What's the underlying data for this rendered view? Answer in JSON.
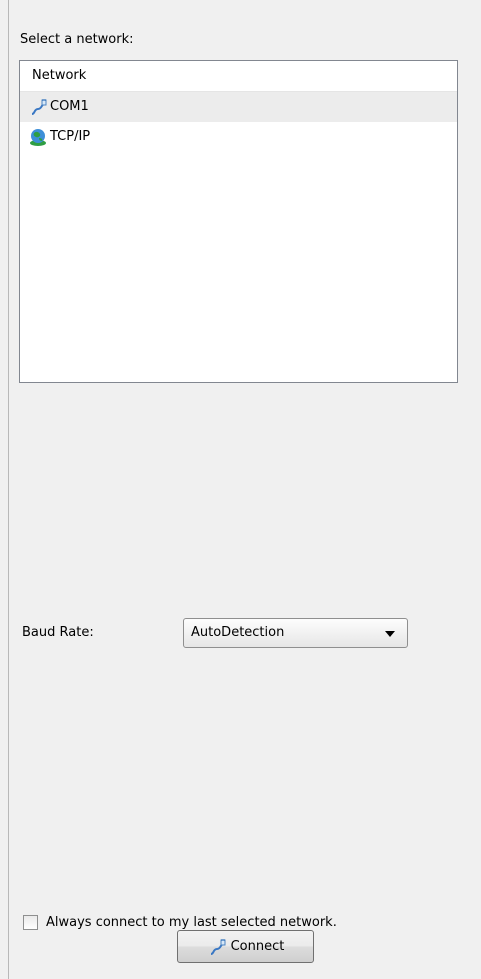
{
  "select_label": "Select a network:",
  "network_list": {
    "header": "Network",
    "items": [
      {
        "label": "COM1",
        "icon": "serial-cable-icon",
        "selected": true
      },
      {
        "label": "TCP/IP",
        "icon": "globe-network-icon",
        "selected": false
      }
    ]
  },
  "baud_rate": {
    "label": "Baud Rate:",
    "selected_value": "AutoDetection"
  },
  "remember": {
    "label": "Always connect to my last selected network.",
    "checked": false
  },
  "connect_button": {
    "label": "Connect",
    "icon": "serial-cable-icon"
  }
}
